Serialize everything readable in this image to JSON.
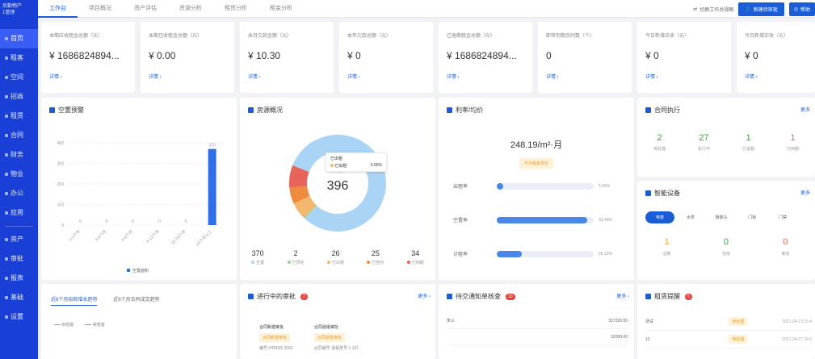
{
  "sidebar": {
    "logo_line1": "后勤物产",
    "logo_line2": "1管理",
    "items": [
      {
        "label": "首页"
      },
      {
        "label": "租客"
      },
      {
        "label": "空间"
      },
      {
        "label": "招商"
      },
      {
        "label": "租赁"
      },
      {
        "label": "合同"
      },
      {
        "label": "财务"
      },
      {
        "label": "物业"
      },
      {
        "label": "办公"
      },
      {
        "label": "应用"
      }
    ],
    "items2": [
      {
        "label": "资产"
      },
      {
        "label": "审批"
      },
      {
        "label": "报表"
      },
      {
        "label": "基础"
      },
      {
        "label": "设置"
      }
    ]
  },
  "tabs": [
    "工作台",
    "项目概况",
    "资产评估",
    "资源分析",
    "租赁分析",
    "租金分析"
  ],
  "top_actions": {
    "switch_view": "切换工作台视图",
    "primary_button": "新建待审批",
    "secondary_button": "帮助"
  },
  "stats": [
    {
      "label": "本期应收租金总额（元）",
      "value": "¥ 1686824894...",
      "link": "详情 ›"
    },
    {
      "label": "本期已收租金总额（元）",
      "value": "¥ 0.00",
      "link": "详情 ›"
    },
    {
      "label": "本月欠款金额（元）",
      "value": "¥ 10.30",
      "link": "详情 ›"
    },
    {
      "label": "本年欠款总额（元）",
      "value": "¥ 0",
      "link": "详情 ›"
    },
    {
      "label": "已逾期租金总额（元）",
      "value": "¥ 1686824894...",
      "link": "详情 ›"
    },
    {
      "label": "即将到期合同数（个）",
      "value": "0",
      "link": "详情 ›"
    },
    {
      "label": "今日新增应收（元）",
      "value": "¥ 0",
      "link": "详情 ›"
    },
    {
      "label": "今日新增实收（元）",
      "value": "¥ 0",
      "link": "详情 ›"
    }
  ],
  "vacancy": {
    "title": "空置预警",
    "legend": "空置面积",
    "chart_data": {
      "type": "bar",
      "categories": [
        "0-3个月",
        "3-6个月",
        "6-9个月",
        "9-12个月",
        "12-24个月",
        "24个月以上"
      ],
      "values": [
        0,
        0,
        0,
        0,
        0,
        370
      ],
      "ylim": [
        0,
        400
      ],
      "yticks": [
        0,
        100,
        200,
        300,
        400
      ]
    }
  },
  "resource": {
    "title": "房源概况",
    "center_label": "房源总数",
    "center_value": "396",
    "tooltip_title": "已出租",
    "tooltip_item": "已出租",
    "tooltip_pct": "5.66%",
    "chart_data": {
      "type": "pie",
      "labels": [
        "空置",
        "已预定",
        "已出租",
        "已签约",
        "已到期"
      ],
      "values": [
        370,
        2,
        26,
        25,
        34
      ],
      "colors": [
        "#a9d4f5",
        "#9ad39a",
        "#f5b66e",
        "#f08a3c",
        "#e8645a"
      ]
    },
    "stats": [
      {
        "value": "370",
        "label": "空置",
        "color": "#a9d4f5"
      },
      {
        "value": "2",
        "label": "已预定",
        "color": "#9ad39a"
      },
      {
        "value": "26",
        "label": "已出租",
        "color": "#f5b66e"
      },
      {
        "value": "25",
        "label": "已签约",
        "color": "#f08a3c"
      },
      {
        "value": "34",
        "label": "已到期",
        "color": "#e8645a"
      }
    ]
  },
  "rate": {
    "title": "利率/均价",
    "price": "248.19/m²·月",
    "price_tag": "平均租金单价",
    "bars": [
      {
        "label": "出租率",
        "value": "5.66%",
        "fraction": 0.0566
      },
      {
        "label": "空置率",
        "value": "93.43%",
        "fraction": 0.9343
      },
      {
        "label": "计租率",
        "value": "26.12%",
        "fraction": 0.2612
      }
    ]
  },
  "contract": {
    "title": "合同执行",
    "more": "更多",
    "items": [
      {
        "value": "2",
        "label": "待处理",
        "color": "#3aa23a"
      },
      {
        "value": "27",
        "label": "执行中",
        "color": "#3aa23a"
      },
      {
        "value": "1",
        "label": "已退租",
        "color": "#3aa23a"
      },
      {
        "value": "1",
        "label": "已到期",
        "color": "#e8645a"
      }
    ]
  },
  "devices": {
    "title": "智能设备",
    "more": "更多",
    "tabs": [
      "电表",
      "水表",
      "摄像头",
      "门锁",
      "门禁"
    ],
    "items": [
      {
        "value": "1",
        "label": "总数",
        "color": "#f5a623"
      },
      {
        "value": "0",
        "label": "在线",
        "color": "#3aa23a"
      },
      {
        "value": "0",
        "label": "离线",
        "color": "#e8645a"
      }
    ]
  },
  "trend": {
    "tabs": [
      "近6个月招商增长趋势",
      "近6个月合同成交趋势"
    ],
    "legend": [
      "新租客",
      "续租客"
    ]
  },
  "approval": {
    "title": "进行中的审批",
    "badge": "2",
    "more": "更多 ›",
    "cards": [
      {
        "title": "合同新建审批",
        "tag": "合同新建审批",
        "info": "编号 HT8026 2001"
      },
      {
        "title": "合同退租审批",
        "tag": "合同退租审批",
        "info": "合同编号 退租单号 1 101"
      }
    ]
  },
  "notice": {
    "title": "待交通知单核查",
    "badge": "10",
    "more": "更多 ›",
    "rows": [
      {
        "name": "朱三",
        "amount": "337320.00"
      },
      {
        "name": "",
        "amount": "32009.00"
      }
    ]
  },
  "reminder": {
    "title": "租赁提醒",
    "badge": "5",
    "rows": [
      {
        "name": "测试",
        "tag": "待处理",
        "date": "2021-04-13 15:4"
      },
      {
        "name": "12",
        "tag": "待处理",
        "date": "2021-04-27 18:0"
      }
    ]
  }
}
